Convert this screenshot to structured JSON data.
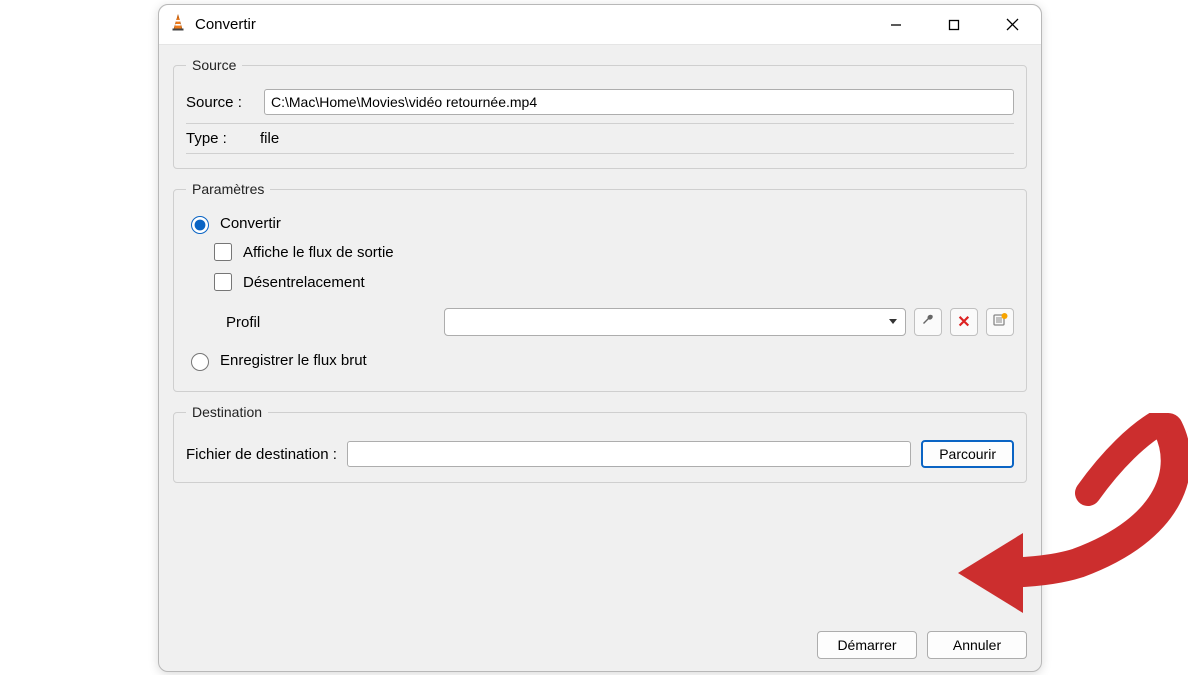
{
  "window": {
    "title": "Convertir"
  },
  "source_group": {
    "legend": "Source",
    "source_label": "Source :",
    "source_value": "C:\\Mac\\Home\\Movies\\vidéo retournée.mp4",
    "type_label": "Type :",
    "type_value": "file"
  },
  "params_group": {
    "legend": "Paramètres",
    "radio_convert": "Convertir",
    "check_show_output": "Affiche le flux de sortie",
    "check_deinterlace": "Désentrelacement",
    "profile_label": "Profil",
    "profile_value": "",
    "radio_dump_raw": "Enregistrer le flux brut"
  },
  "dest_group": {
    "legend": "Destination",
    "dest_label": "Fichier de destination :",
    "dest_value": "",
    "browse_label": "Parcourir"
  },
  "footer": {
    "start_label": "Démarrer",
    "cancel_label": "Annuler"
  },
  "colors": {
    "arrow": "#cc2e2e",
    "accent": "#0a64c4"
  }
}
